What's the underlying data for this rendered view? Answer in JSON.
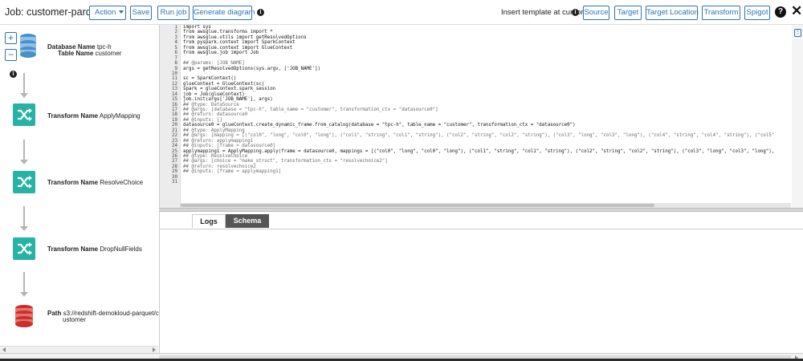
{
  "header": {
    "job_title": "Job: customer-parquet",
    "action_label": "Action",
    "save_label": "Save",
    "run_job_label": "Run job",
    "generate_diagram_label": "Generate diagram",
    "insert_template_label": "Insert template at cursor",
    "template_buttons": [
      "Source",
      "Target",
      "Target Location",
      "Transform",
      "Spigot"
    ]
  },
  "diagram": {
    "zoom_in": "+",
    "zoom_out": "−",
    "source": {
      "db_key": "Database Name",
      "db_val": "tpc-h",
      "table_key": "Table Name",
      "table_val": "customer"
    },
    "transforms": [
      {
        "key": "Transform Name",
        "val": "ApplyMapping"
      },
      {
        "key": "Transform Name",
        "val": "ResolveChoice"
      },
      {
        "key": "Transform Name",
        "val": "DropNullFields"
      }
    ],
    "target": {
      "key": "Path",
      "val_line1": "s3://redshift-demokloud-parquet/c",
      "val_line2": "ustomer"
    }
  },
  "editor": {
    "lines": [
      "import sys",
      "from awsglue.transforms import *",
      "from awsglue.utils import getResolvedOptions",
      "from pyspark.context import SparkContext",
      "from awsglue.context import GlueContext",
      "from awsglue.job import Job",
      "",
      "## @params: [JOB_NAME]",
      "args = getResolvedOptions(sys.argv, ['JOB_NAME'])",
      "",
      "sc = SparkContext()",
      "glueContext = GlueContext(sc)",
      "spark = glueContext.spark_session",
      "job = Job(glueContext)",
      "job.init(args['JOB_NAME'], args)",
      "## @type: DataSource",
      "## @args: [database = \"tpc-h\", table_name = \"customer\", transformation_ctx = \"datasource0\"]",
      "## @return: datasource0",
      "## @inputs: []",
      "datasource0 = glueContext.create_dynamic_frame.from_catalog(database = \"tpc-h\", table_name = \"customer\", transformation_ctx = \"datasource0\")",
      "## @type: ApplyMapping",
      "## @args: [mapping = [(\"col0\", \"long\", \"col0\", \"long\"), (\"col1\", \"string\", \"col1\", \"string\"), (\"col2\", \"string\", \"col2\", \"string\"), (\"col3\", \"long\", \"col3\", \"long\"), (\"col4\", \"string\", \"col4\", \"string\"), (\"col5\"",
      "## @return: applymapping1",
      "## @inputs: [frame = datasource0]",
      "applymapping1 = ApplyMapping.apply(frame = datasource0, mappings = [(\"col0\", \"long\", \"col0\", \"long\"), (\"col1\", \"string\", \"col1\", \"string\"), (\"col2\", \"string\", \"col2\", \"string\"), (\"col3\", \"long\", \"col3\", \"long\"),",
      "## @type: ResolveChoice",
      "## @args: [choice = \"make_struct\", transformation_ctx = \"resolvechoice2\"]",
      "## @return: resolvechoice2",
      "## @inputs: [frame = applymapping1]",
      "",
      ""
    ],
    "line_numbers": [
      "1",
      "2",
      "3",
      "4",
      "5",
      "6",
      "7",
      "8",
      "9",
      "10",
      "11",
      "12",
      "13",
      "14",
      "15",
      "16",
      "17",
      "18",
      "19",
      "20",
      "21",
      "22",
      "23",
      "24",
      "25",
      "26",
      "27",
      "28",
      "29",
      "30",
      "31"
    ]
  },
  "tabs": {
    "logs": "Logs",
    "schema": "Schema"
  },
  "colors": {
    "accent": "#2e73b8",
    "transform": "#27b3a3",
    "database": "#4a90c8",
    "target": "#d9534f"
  }
}
